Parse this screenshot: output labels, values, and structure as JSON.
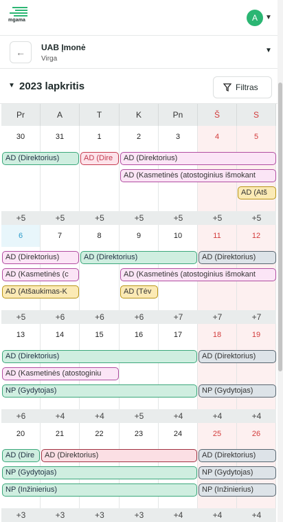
{
  "app": {
    "logo_text": "mgama",
    "avatar_initial": "A"
  },
  "company": {
    "name": "UAB Įmonė",
    "sub": "Virga"
  },
  "month": {
    "title": "2023 lapkritis",
    "filter_label": "Filtras"
  },
  "weekdays": [
    "Pr",
    "A",
    "T",
    "K",
    "Pn",
    "Š",
    "S"
  ],
  "weeks": [
    {
      "dates": [
        "30",
        "31",
        "1",
        "2",
        "3",
        "4",
        "5"
      ],
      "today": -1,
      "events": [
        {
          "label": "AD (Direktorius)",
          "color": "green",
          "start": 0,
          "span": 2,
          "row": 0
        },
        {
          "label": "AD (Dire",
          "color": "orangepink",
          "start": 2,
          "span": 1,
          "row": 0
        },
        {
          "label": "AD (Direktorius)",
          "color": "pink",
          "start": 3,
          "span": 4,
          "row": 0
        },
        {
          "label": "AD (Kasmetinės (atostoginius išmokant",
          "color": "pink",
          "start": 3,
          "span": 4,
          "row": 1
        },
        {
          "label": "AD (Atš",
          "color": "yellow",
          "start": 6,
          "span": 1,
          "row": 2
        }
      ],
      "more": [
        "+5",
        "+5",
        "+5",
        "+5",
        "+5",
        "+5",
        "+5"
      ]
    },
    {
      "dates": [
        "6",
        "7",
        "8",
        "9",
        "10",
        "11",
        "12"
      ],
      "today": 0,
      "events": [
        {
          "label": "AD (Direktorius)",
          "color": "pink",
          "start": 0,
          "span": 2,
          "row": 0
        },
        {
          "label": "AD (Direktorius)",
          "color": "green",
          "start": 2,
          "span": 3,
          "row": 0
        },
        {
          "label": "AD (Direktorius)",
          "color": "grey",
          "start": 5,
          "span": 2,
          "row": 0
        },
        {
          "label": "AD (Kasmetinės (c",
          "color": "pink",
          "start": 0,
          "span": 2,
          "row": 1
        },
        {
          "label": "AD (Kasmetinės (atostoginius išmokant",
          "color": "pink",
          "start": 3,
          "span": 4,
          "row": 1
        },
        {
          "label": "AD (Atšaukimas-K",
          "color": "yellow",
          "start": 0,
          "span": 2,
          "row": 2
        },
        {
          "label": "AD (Tėv",
          "color": "yellow",
          "start": 3,
          "span": 1,
          "row": 2
        }
      ],
      "more": [
        "+5",
        "+6",
        "+6",
        "+6",
        "+7",
        "+7",
        "+7"
      ]
    },
    {
      "dates": [
        "13",
        "14",
        "15",
        "16",
        "17",
        "18",
        "19"
      ],
      "today": -1,
      "events": [
        {
          "label": "AD (Direktorius)",
          "color": "green",
          "start": 0,
          "span": 5,
          "row": 0
        },
        {
          "label": "AD (Direktorius)",
          "color": "grey",
          "start": 5,
          "span": 2,
          "row": 0
        },
        {
          "label": "AD (Kasmetinės (atostoginiu",
          "color": "pink",
          "start": 0,
          "span": 3,
          "row": 1
        },
        {
          "label": "NP (Gydytojas)",
          "color": "green",
          "start": 0,
          "span": 5,
          "row": 2
        },
        {
          "label": "NP (Gydytojas)",
          "color": "grey",
          "start": 5,
          "span": 2,
          "row": 2
        }
      ],
      "more": [
        "+6",
        "+4",
        "+4",
        "+5",
        "+4",
        "+4",
        "+4"
      ]
    },
    {
      "dates": [
        "20",
        "21",
        "22",
        "23",
        "24",
        "25",
        "26"
      ],
      "today": -1,
      "events": [
        {
          "label": "AD (Dire",
          "color": "green",
          "start": 0,
          "span": 1,
          "row": 0
        },
        {
          "label": "AD (Direktorius)",
          "color": "red2",
          "start": 1,
          "span": 4,
          "row": 0
        },
        {
          "label": "AD (Direktorius)",
          "color": "grey",
          "start": 5,
          "span": 2,
          "row": 0
        },
        {
          "label": "NP (Gydytojas)",
          "color": "green",
          "start": 0,
          "span": 5,
          "row": 1
        },
        {
          "label": "NP (Gydytojas)",
          "color": "grey",
          "start": 5,
          "span": 2,
          "row": 1
        },
        {
          "label": "NP (Inžinierius)",
          "color": "green",
          "start": 0,
          "span": 5,
          "row": 2
        },
        {
          "label": "NP (Inžinierius)",
          "color": "grey",
          "start": 5,
          "span": 2,
          "row": 2
        }
      ],
      "more": [
        "+3",
        "+3",
        "+3",
        "+3",
        "+4",
        "+4",
        "+4"
      ]
    }
  ]
}
